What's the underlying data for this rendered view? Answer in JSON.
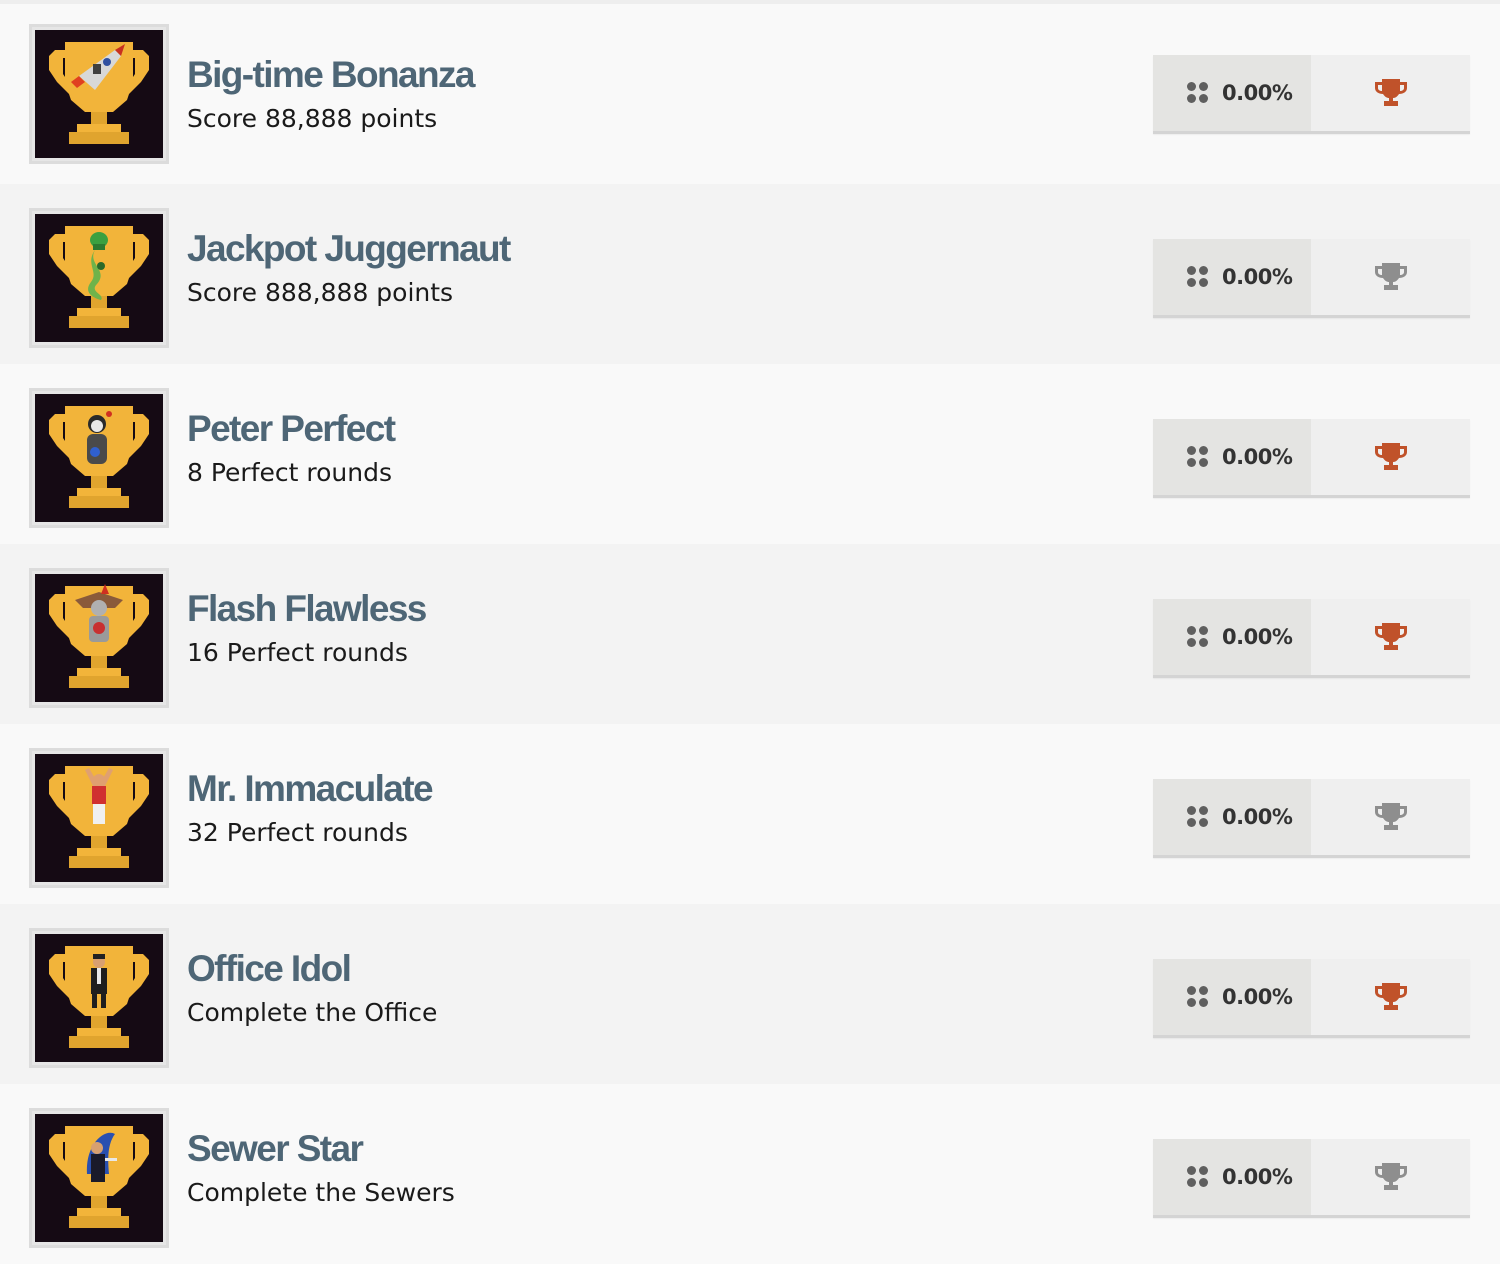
{
  "achievements": [
    {
      "title": "Big-time Bonanza",
      "description": "Score 88,888 points",
      "percent": "0.00%",
      "trophy": "bronze-trophy-icon",
      "trophy_color": "#c0522a",
      "figure": "rocket"
    },
    {
      "title": "Jackpot Juggernaut",
      "description": "Score 888,888 points",
      "percent": "0.00%",
      "trophy": "silver-trophy-icon",
      "trophy_color": "#8e8e8e",
      "figure": "lizard"
    },
    {
      "title": "Peter Perfect",
      "description": "8 Perfect rounds",
      "percent": "0.00%",
      "trophy": "bronze-trophy-icon",
      "trophy_color": "#c0522a",
      "figure": "panda"
    },
    {
      "title": "Flash Flawless",
      "description": "16 Perfect rounds",
      "percent": "0.00%",
      "trophy": "bronze-trophy-icon",
      "trophy_color": "#c0522a",
      "figure": "knight"
    },
    {
      "title": "Mr. Immaculate",
      "description": "32 Perfect rounds",
      "percent": "0.00%",
      "trophy": "silver-trophy-icon",
      "trophy_color": "#8e8e8e",
      "figure": "athlete"
    },
    {
      "title": "Office Idol",
      "description": "Complete the Office",
      "percent": "0.00%",
      "trophy": "bronze-trophy-icon",
      "trophy_color": "#c0522a",
      "figure": "businessman"
    },
    {
      "title": "Sewer Star",
      "description": "Complete the Sewers",
      "percent": "0.00%",
      "trophy": "silver-trophy-icon",
      "trophy_color": "#8e8e8e",
      "figure": "wizard"
    }
  ],
  "colors": {
    "title": "#4e6676",
    "gold": "#f2b43a",
    "thumb_bg": "#150a14",
    "bronze": "#c0522a",
    "silver": "#8e8e8e"
  }
}
